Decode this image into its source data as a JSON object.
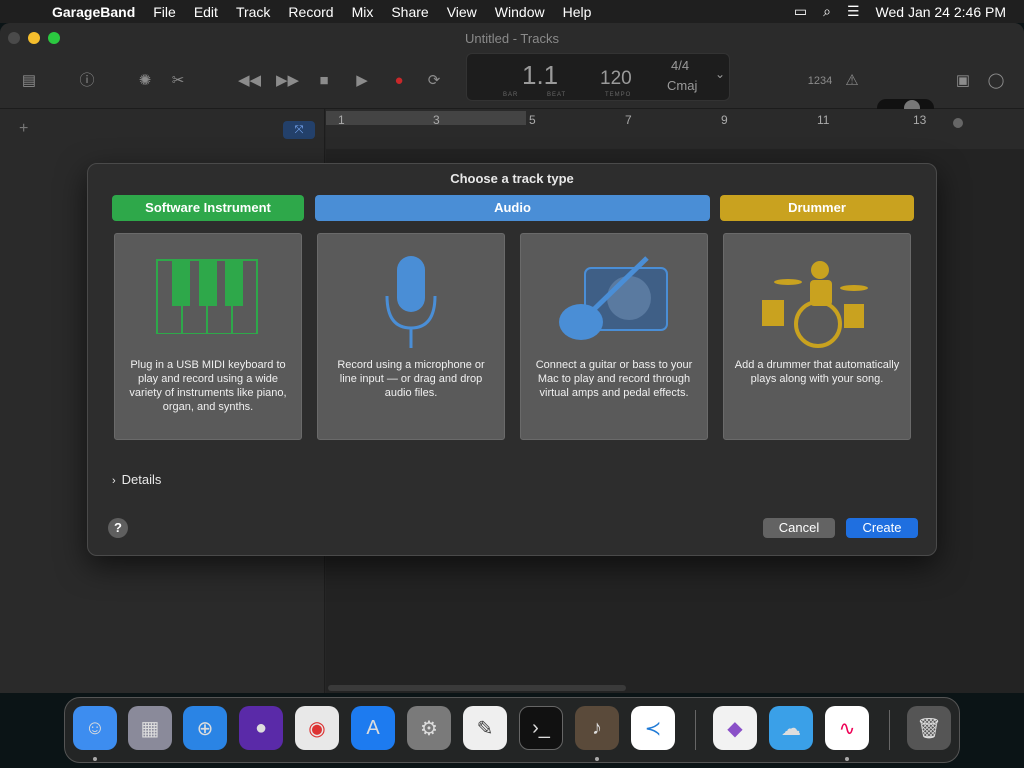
{
  "menubar": {
    "app": "GarageBand",
    "items": [
      "File",
      "Edit",
      "Track",
      "Record",
      "Mix",
      "Share",
      "View",
      "Window",
      "Help"
    ],
    "datetime": "Wed Jan 24  2:46 PM"
  },
  "window": {
    "title": "Untitled - Tracks"
  },
  "lcd": {
    "position": "1.1",
    "tempo": "120",
    "signature": "4/4",
    "key": "Cmaj",
    "bar_label": "BAR",
    "beat_label": "BEAT",
    "tempo_label": "TEMPO",
    "counter_label": "1234"
  },
  "ruler": {
    "marks": [
      "1",
      "3",
      "5",
      "7",
      "9",
      "11",
      "13"
    ]
  },
  "dialog": {
    "title": "Choose a track type",
    "categories": {
      "software": "Software Instrument",
      "audio": "Audio",
      "drummer": "Drummer"
    },
    "cards": {
      "keyboard": "Plug in a USB MIDI keyboard to play and record using a wide variety of instruments like piano, organ, and synths.",
      "microphone": "Record using a microphone or line input — or drag and drop audio files.",
      "guitar": "Connect a guitar or bass to your Mac to play and record through virtual amps and pedal effects.",
      "drummer": "Add a drummer that automatically plays along with your song."
    },
    "details": "Details",
    "help": "?",
    "cancel": "Cancel",
    "create": "Create"
  },
  "colors": {
    "software": "#2ea84a",
    "audio": "#4a8ed6",
    "drummer": "#c9a21f",
    "create": "#1f6fe0"
  }
}
